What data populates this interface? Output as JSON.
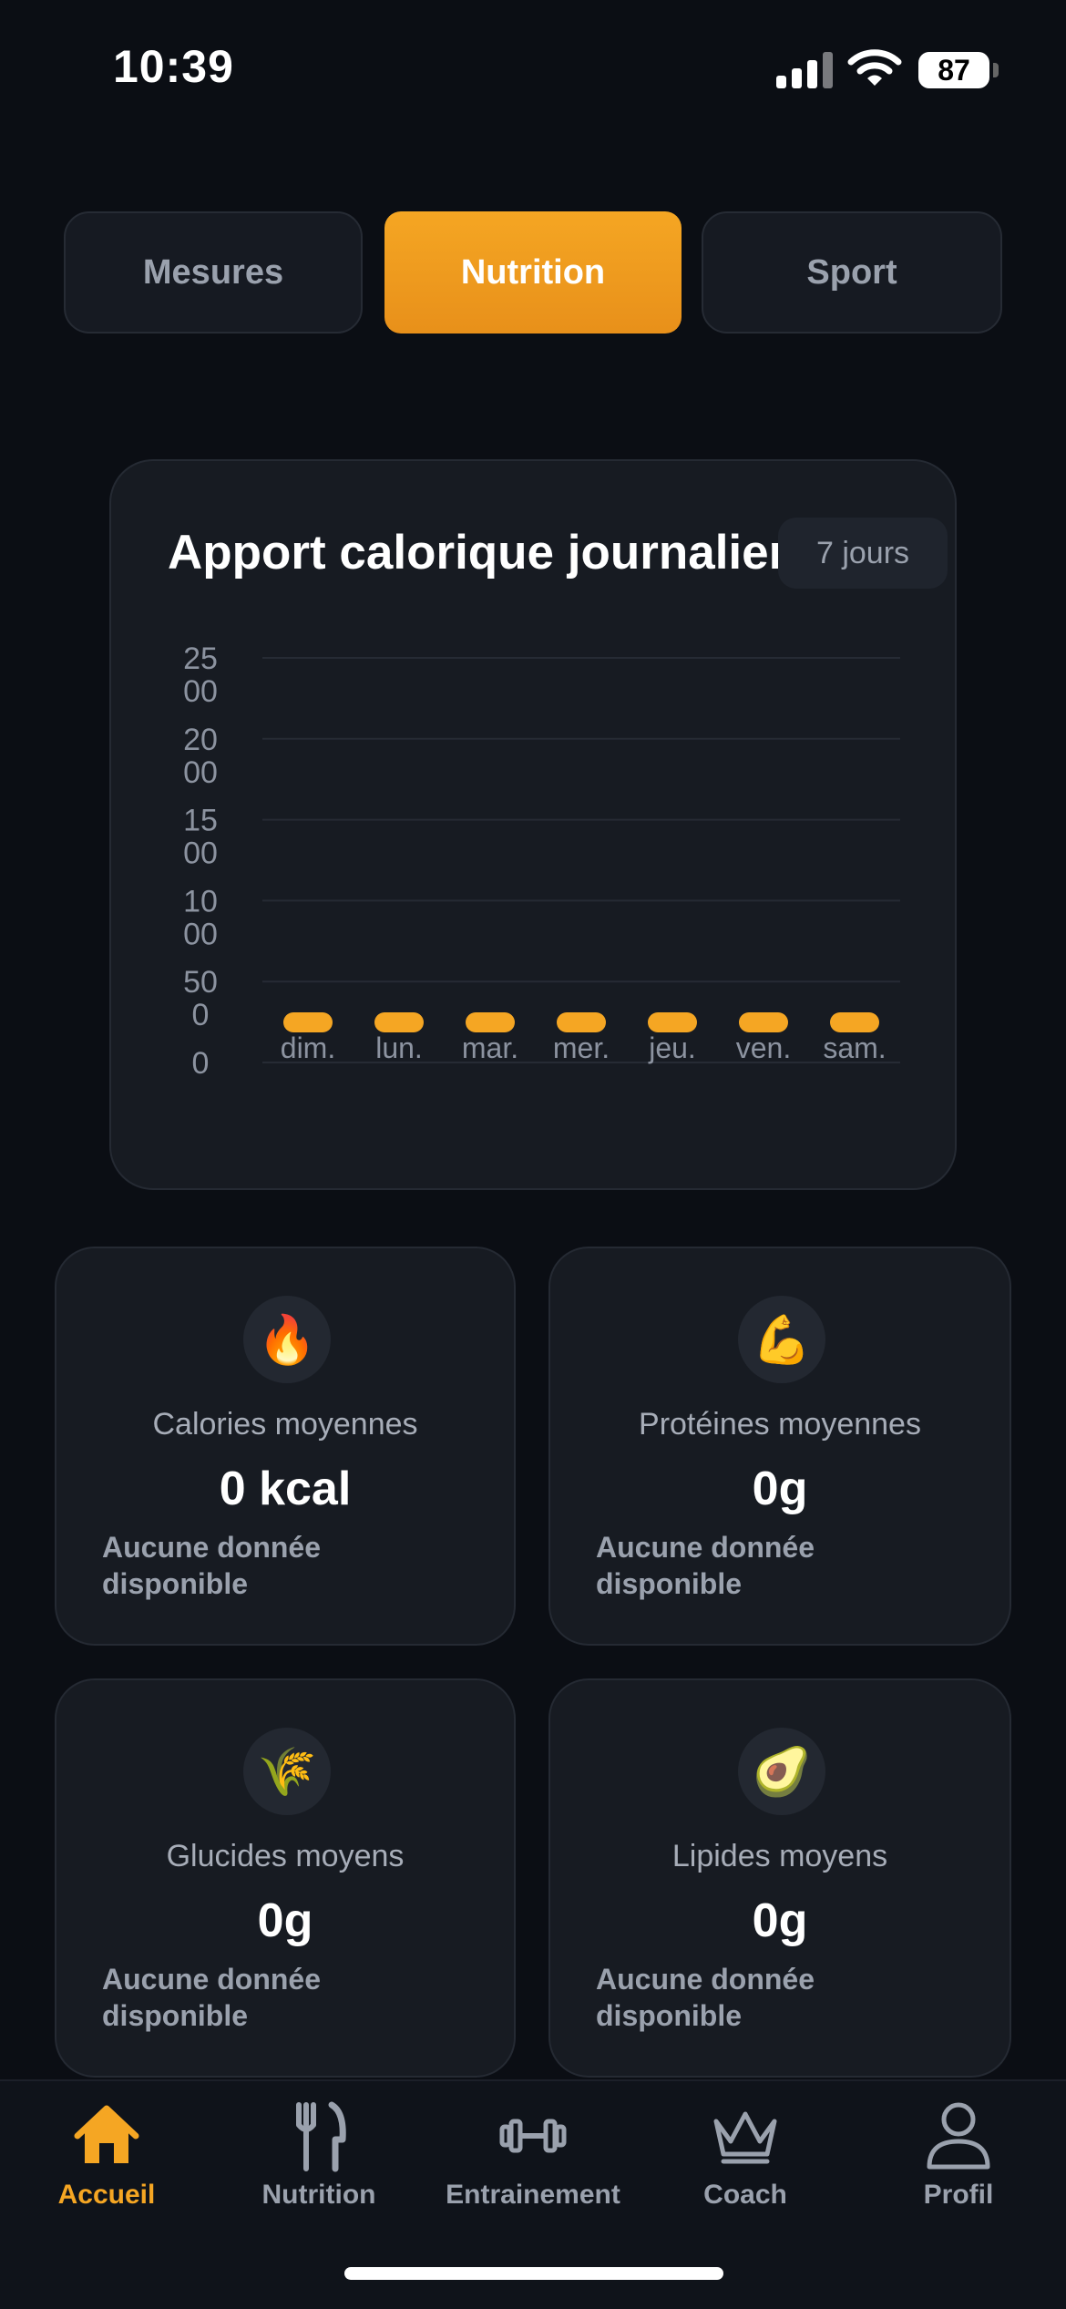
{
  "status": {
    "time": "10:39",
    "battery": "87"
  },
  "segments": [
    {
      "label": "Mesures",
      "active": false
    },
    {
      "label": "Nutrition",
      "active": true
    },
    {
      "label": "Sport",
      "active": false
    }
  ],
  "chart_card": {
    "title": "Apport calorique journalier",
    "period": "7 jours"
  },
  "chart_data": {
    "type": "bar",
    "categories": [
      "dim.",
      "lun.",
      "mar.",
      "mer.",
      "jeu.",
      "ven.",
      "sam."
    ],
    "values": [
      0,
      0,
      0,
      0,
      0,
      0,
      0
    ],
    "ylim": [
      0,
      2500
    ],
    "ytick_labels": [
      {
        "line1": "25",
        "line2": "00"
      },
      {
        "line1": "20",
        "line2": "00"
      },
      {
        "line1": "15",
        "line2": "00"
      },
      {
        "line1": "10",
        "line2": "00"
      },
      {
        "line1": "50",
        "line2": "0"
      },
      {
        "line1": "0",
        "line2": ""
      }
    ],
    "grid": true,
    "bar_color": "#f5a623"
  },
  "stats": [
    {
      "icon": "fire-icon",
      "emoji": "🔥",
      "label": "Calories moyennes",
      "value": "0 kcal",
      "note": "Aucune donnée disponible"
    },
    {
      "icon": "flexed-biceps-icon",
      "emoji": "💪",
      "label": "Protéines moyennes",
      "value": "0g",
      "note": "Aucune donnée disponible"
    },
    {
      "icon": "rice-icon",
      "emoji": "🌾",
      "label": "Glucides moyens",
      "value": "0g",
      "note": "Aucune donnée disponible"
    },
    {
      "icon": "avocado-icon",
      "emoji": "🥑",
      "label": "Lipides moyens",
      "value": "0g",
      "note": "Aucune donnée disponible"
    }
  ],
  "tabbar": [
    {
      "label": "Accueil",
      "icon": "home-icon",
      "active": true
    },
    {
      "label": "Nutrition",
      "icon": "fork-knife-icon",
      "active": false
    },
    {
      "label": "Entrainement",
      "icon": "dumbbell-icon",
      "active": false
    },
    {
      "label": "Coach",
      "icon": "crown-icon",
      "active": false
    },
    {
      "label": "Profil",
      "icon": "person-icon",
      "active": false
    }
  ],
  "colors": {
    "accent": "#f5a623",
    "background": "#0b0e14",
    "card": "#171b22"
  }
}
